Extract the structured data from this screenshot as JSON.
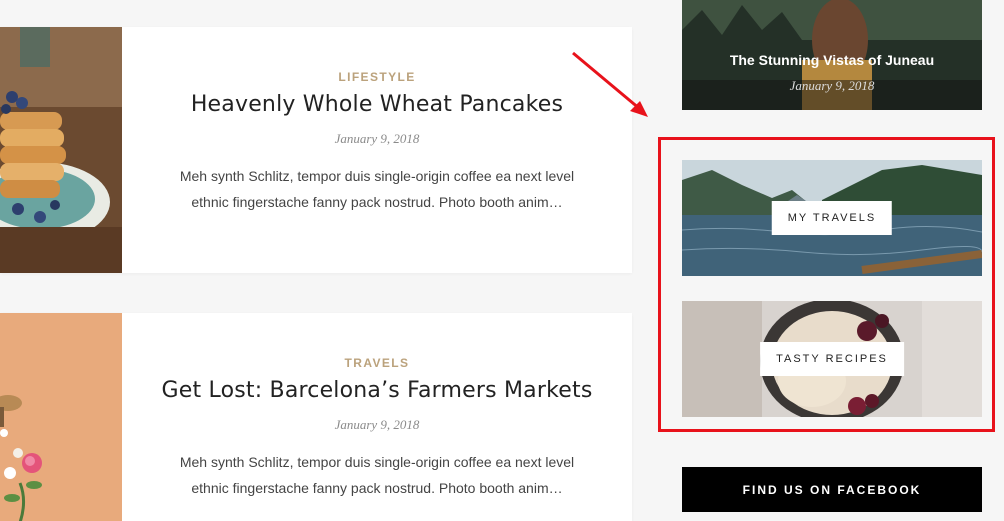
{
  "posts": [
    {
      "category": "LIFESTYLE",
      "title": "Heavenly Whole Wheat Pancakes",
      "date": "January 9, 2018",
      "excerpt": "Meh synth Schlitz, tempor duis single-origin coffee ea next level ethnic fingerstache fanny pack nostrud. Photo booth anim…",
      "image": "pancakes-image"
    },
    {
      "category": "TRAVELS",
      "title": "Get Lost: Barcelona’s Farmers Markets",
      "date": "January 9, 2018",
      "excerpt": "Meh synth Schlitz, tempor duis single-origin coffee ea next level ethnic fingerstache fanny pack nostrud. Photo booth anim…",
      "image": "flowers-image"
    }
  ],
  "sidebar": {
    "featured": {
      "title": "The Stunning Vistas of Juneau",
      "date": "January 9, 2018"
    },
    "banners": [
      {
        "label": "MY TRAVELS",
        "image": "lake-mountains-image"
      },
      {
        "label": "TASTY RECIPES",
        "image": "ice-cream-berries-image"
      }
    ],
    "facebook_button": "FIND US ON FACEBOOK"
  },
  "annotation": {
    "color": "#e8121b"
  },
  "colors": {
    "category": "#bba27c",
    "background": "#f6f6f6"
  }
}
